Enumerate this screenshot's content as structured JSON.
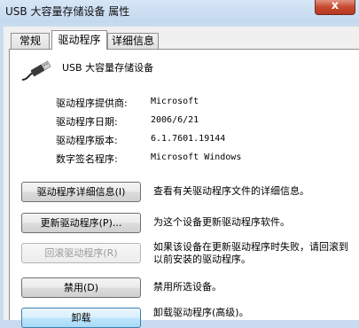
{
  "window": {
    "title": "USB 大容量存储设备 属性",
    "close_glyph": "x"
  },
  "tabs": [
    {
      "label": "常规",
      "active": false
    },
    {
      "label": "驱动程序",
      "active": true
    },
    {
      "label": "详细信息",
      "active": false
    }
  ],
  "device": {
    "name": "USB 大容量存储设备",
    "icon": "usb-plug-icon"
  },
  "properties": [
    {
      "label": "驱动程序提供商:",
      "value": "Microsoft"
    },
    {
      "label": "驱动程序日期:",
      "value": "2006/6/21"
    },
    {
      "label": "驱动程序版本:",
      "value": "6.1.7601.19144"
    },
    {
      "label": "数字签名程序:",
      "value": "Microsoft Windows"
    }
  ],
  "actions": [
    {
      "button": "驱动程序详细信息(I)",
      "description": "查看有关驱动程序文件的详细信息。",
      "enabled": true
    },
    {
      "button": "更新驱动程序(P)...",
      "description": "为这个设备更新驱动程序软件。",
      "enabled": true
    },
    {
      "button": "回滚驱动程序(R)",
      "description": "如果该设备在更新驱动程序时失败，请回滚到以前安装的驱动程序。",
      "enabled": false
    },
    {
      "button": "禁用(D)",
      "description": "禁用所选设备。",
      "enabled": true
    },
    {
      "button": "卸载",
      "description": "卸载驱动程序(高级)。",
      "enabled": true
    }
  ],
  "colors": {
    "window_frame": "#c9dcef",
    "close_button": "#c8492f",
    "focus_border": "#3c7fb1"
  }
}
